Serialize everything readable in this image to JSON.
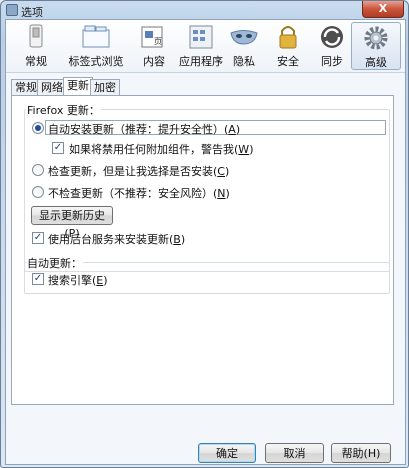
{
  "window": {
    "title": "选项",
    "close_glyph": "X"
  },
  "toolbar": {
    "items": [
      {
        "label": "常规",
        "icon": "switch-icon"
      },
      {
        "label": "标签式浏览",
        "icon": "tabs-icon"
      },
      {
        "label": "内容",
        "icon": "content-icon"
      },
      {
        "label": "应用程序",
        "icon": "applications-icon"
      },
      {
        "label": "隐私",
        "icon": "privacy-mask-icon"
      },
      {
        "label": "安全",
        "icon": "lock-icon"
      },
      {
        "label": "同步",
        "icon": "sync-icon"
      },
      {
        "label": "高级",
        "icon": "gear-icon",
        "active": true
      }
    ]
  },
  "advanced_tabs": [
    {
      "label": "常规"
    },
    {
      "label": "网络"
    },
    {
      "label": "更新",
      "active": true
    },
    {
      "label": "加密"
    }
  ],
  "updates": {
    "firefox_group_title": "Firefox 更新：",
    "auto_install": {
      "text": "自动安装更新（推荐：提升安全性）(",
      "key": "A",
      "suffix": ")",
      "checked": true
    },
    "warn_addons": {
      "text": "如果将禁用任何附加组件，警告我(",
      "key": "W",
      "suffix": ")",
      "checked": true
    },
    "check_ask": {
      "text": "检查更新，但是让我选择是否安装(",
      "key": "C",
      "suffix": ")",
      "checked": false
    },
    "never_check": {
      "text": "不检查更新（不推荐：安全风险）(",
      "key": "N",
      "suffix": ")",
      "checked": false
    },
    "show_history_button": "显示更新历史(P)",
    "background_service": {
      "text": "使用后台服务来安装更新(",
      "key": "B",
      "suffix": ")",
      "checked": true
    },
    "auto_group_title": "自动更新：",
    "search_engines": {
      "text": "搜索引擎(",
      "key": "E",
      "suffix": ")",
      "checked": true
    }
  },
  "footer": {
    "ok_label": "确定",
    "cancel_label": "取消",
    "help_label": "帮助(H)"
  },
  "colors": {
    "accent": "#1f4f99",
    "title_bar": "#c9dcef",
    "close": "#c9553d"
  }
}
